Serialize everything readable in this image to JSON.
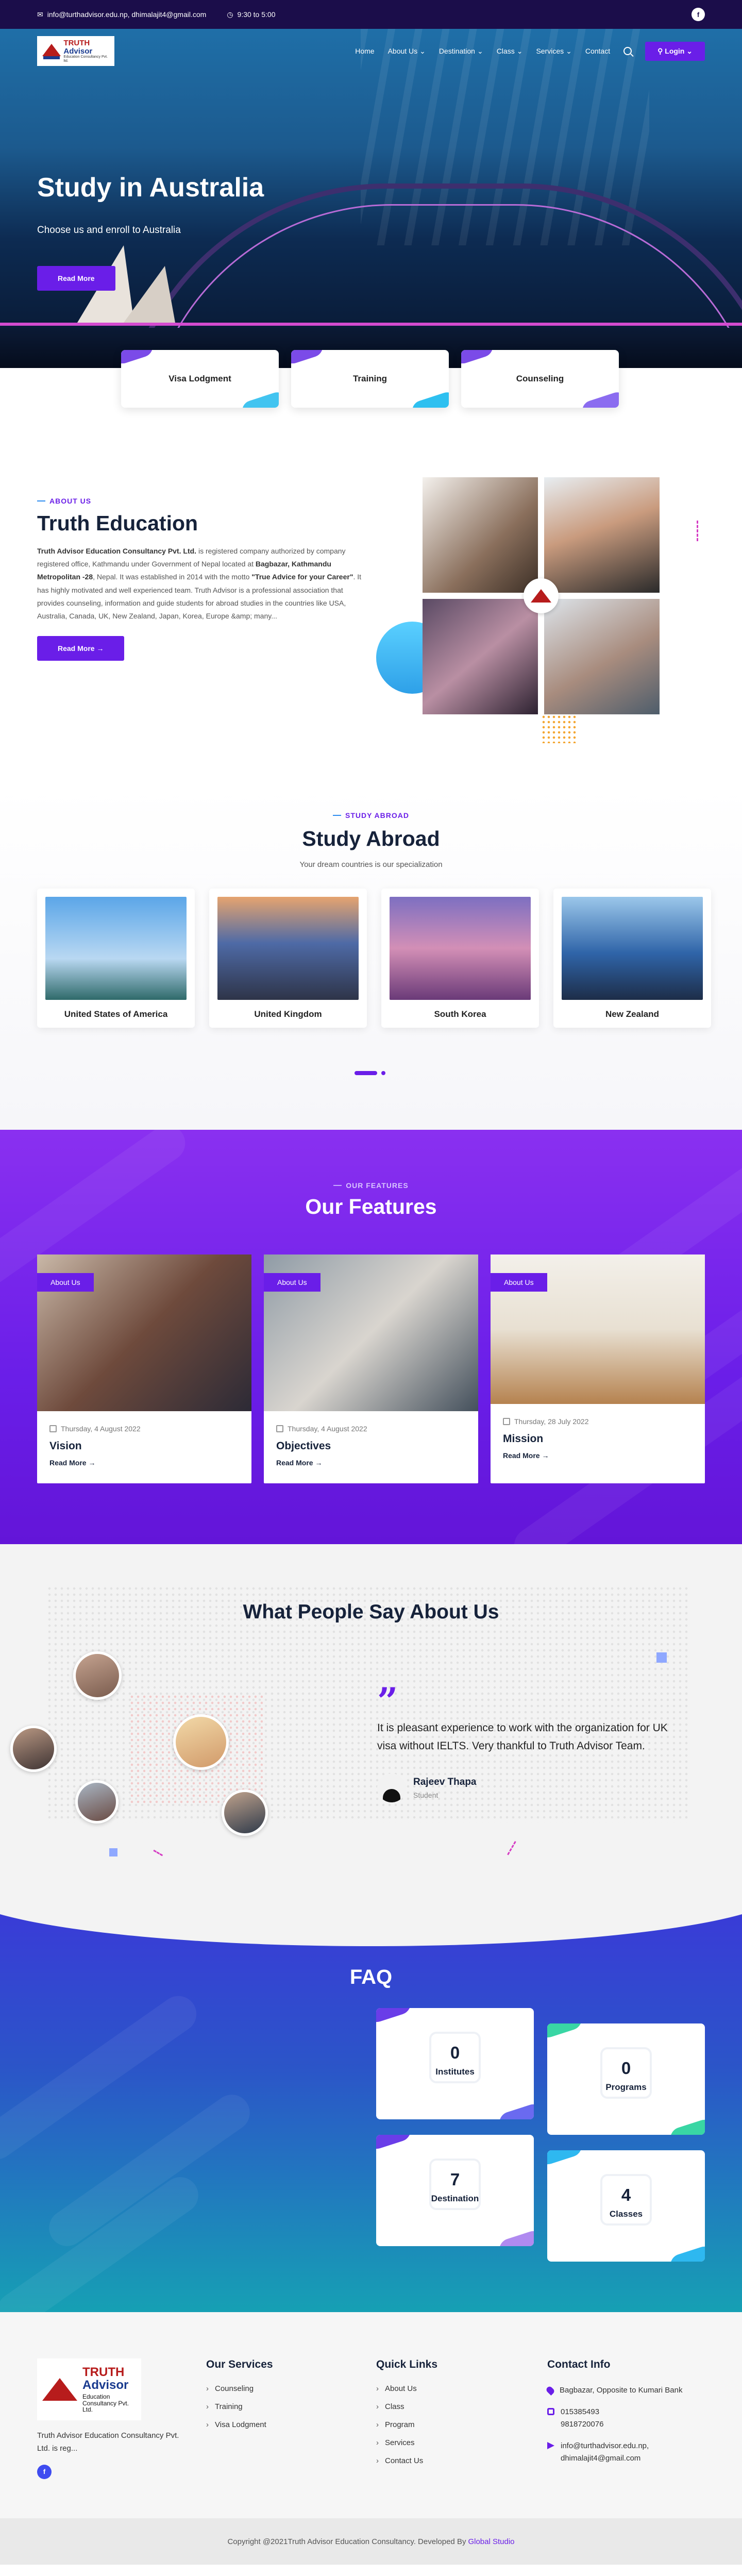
{
  "topbar": {
    "email": "info@turthadvisor.edu.np, dhimalajit4@gmail.com",
    "hours": "9:30 to 5:00",
    "social_icon": "facebook-icon"
  },
  "brand": {
    "logo_line1": "TRUTH",
    "logo_line2": "Advisor",
    "logo_line3": "Education Consultancy Pvt. ltd.",
    "footer_logo_line3": "Education Consultancy Pvt. Ltd."
  },
  "nav": {
    "items": [
      "Home",
      "About Us",
      "Destination",
      "Class",
      "Services",
      "Contact"
    ],
    "login": "Login"
  },
  "hero": {
    "title": "Study in Australia",
    "subtitle": "Choose us and enroll to Australia",
    "button": "Read More"
  },
  "services": [
    "Visa Lodgment",
    "Training",
    "Counseling"
  ],
  "about": {
    "eyebrow": "ABOUT US",
    "title": "Truth Education",
    "company": "Truth Advisor Education Consultancy Pvt. Ltd.",
    "text1": " is registered company authorized by company registered office, Kathmandu under Government of Nepal located at ",
    "location": "Bagbazar, Kathmandu Metropolitan -28",
    "text2": ", Nepal. It was established in 2014 with the motto ",
    "motto": "\"True Advice for your Career\"",
    "text3": ". It has highly motivated and well experienced team. Truth Advisor is a professional association that provides counseling, information and guide students for abroad studies in the countries like USA, Australia, Canada, UK, New Zealand, Japan, Korea, Europe &amp; many...",
    "button": "Read More"
  },
  "study": {
    "eyebrow": "STUDY ABROAD",
    "title": "Study Abroad",
    "lead": "Your dream countries is our specialization",
    "countries": [
      "United States of America",
      "United Kingdom",
      "South Korea",
      "New Zealand"
    ]
  },
  "features": {
    "eyebrow": "OUR FEATURES",
    "title": "Our Features",
    "cards": [
      {
        "tag": "About Us",
        "date": "Thursday, 4 August 2022",
        "title": "Vision",
        "link": "Read More"
      },
      {
        "tag": "About Us",
        "date": "Thursday, 4 August 2022",
        "title": "Objectives",
        "link": "Read More"
      },
      {
        "tag": "About Us",
        "date": "Thursday, 28 July 2022",
        "title": "Mission",
        "link": "Read More"
      }
    ]
  },
  "testimonials": {
    "title": "What People Say About Us",
    "quote": "It is pleasant experience to work with the organization for UK visa without IELTS. Very thankful to Truth Advisor Team.",
    "name": "Rajeev Thapa",
    "role": "Student"
  },
  "faq": {
    "title": "FAQ",
    "counters": [
      {
        "value": "0",
        "label": "Institutes"
      },
      {
        "value": "0",
        "label": "Programs"
      },
      {
        "value": "7",
        "label": "Destination"
      },
      {
        "value": "4",
        "label": "Classes"
      }
    ]
  },
  "footer": {
    "desc": "Truth Advisor Education Consultancy Pvt. Ltd. is reg...",
    "services_title": "Our Services",
    "services": [
      "Counseling",
      "Training",
      "Visa Lodgment"
    ],
    "links_title": "Quick Links",
    "links": [
      "About Us",
      "Class",
      "Program",
      "Services",
      "Contact Us"
    ],
    "contact_title": "Contact Info",
    "address": "Bagbazar, Opposite to Kumari Bank",
    "phone1": "015385493",
    "phone2": "9818720076",
    "email1": "info@turthadvisor.edu.np,",
    "email2": "dhimalajit4@gmail.com",
    "copyright": "Copyright @2021Truth Advisor Education Consultancy. Developed By",
    "developer": "Global Studio"
  },
  "colors": {
    "accent": "#6a1ee8",
    "topbar": "#1b0d4a",
    "features_bg": "#7a22ee",
    "faq_bg": "#2b55c8"
  }
}
